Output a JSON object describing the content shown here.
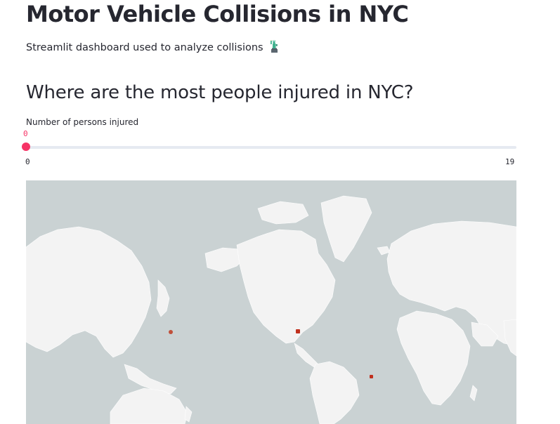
{
  "header": {
    "title": "Motor Vehicle Collisions in NYC",
    "subtitle": "Streamlit dashboard used to analyze collisions",
    "subtitle_emoji": "statue-of-liberty-icon"
  },
  "section": {
    "heading": "Where are the most people injured in NYC?"
  },
  "slider": {
    "label": "Number of persons injured",
    "value": "0",
    "min": "0",
    "max": "19",
    "accent_color": "#f63366",
    "track_color": "#e6eaf1"
  },
  "map": {
    "water_color": "#cad2d3",
    "land_color": "#f3f3f3",
    "point_color": "#c0301e"
  }
}
